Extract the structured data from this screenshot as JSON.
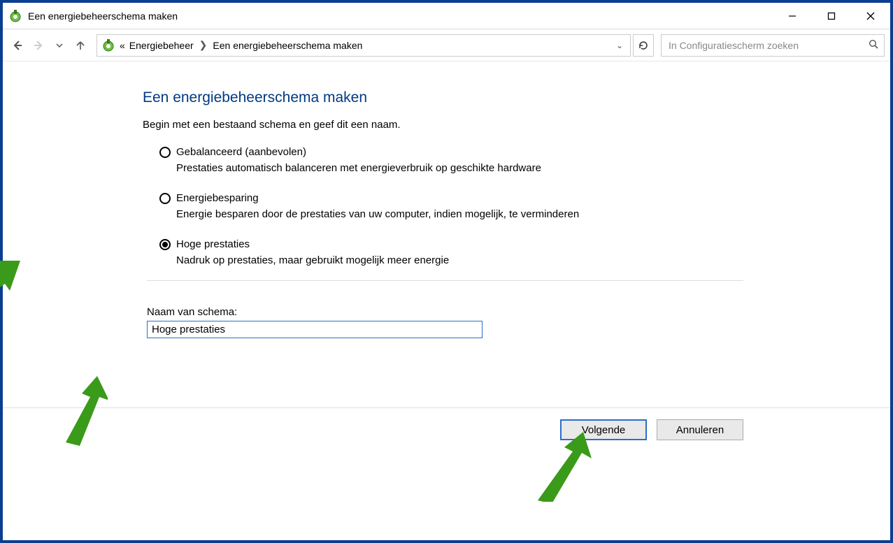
{
  "window": {
    "title": "Een energiebeheerschema maken"
  },
  "breadcrumb": {
    "item0": "«",
    "item1": "Energiebeheer",
    "item2": "Een energiebeheerschema maken"
  },
  "search": {
    "placeholder": "In Configuratiescherm zoeken"
  },
  "page": {
    "heading": "Een energiebeheerschema maken",
    "subtitle": "Begin met een bestaand schema en geef dit een naam."
  },
  "plans": [
    {
      "label": "Gebalanceerd (aanbevolen)",
      "desc": "Prestaties automatisch balanceren met energieverbruik op geschikte hardware",
      "checked": false
    },
    {
      "label": "Energiebesparing",
      "desc": "Energie besparen door de prestaties van uw computer, indien mogelijk, te verminderen",
      "checked": false
    },
    {
      "label": "Hoge prestaties",
      "desc": "Nadruk op prestaties, maar gebruikt mogelijk meer energie",
      "checked": true
    }
  ],
  "planName": {
    "label": "Naam van schema:",
    "value": "Hoge prestaties"
  },
  "buttons": {
    "next": "Volgende",
    "cancel": "Annuleren"
  }
}
